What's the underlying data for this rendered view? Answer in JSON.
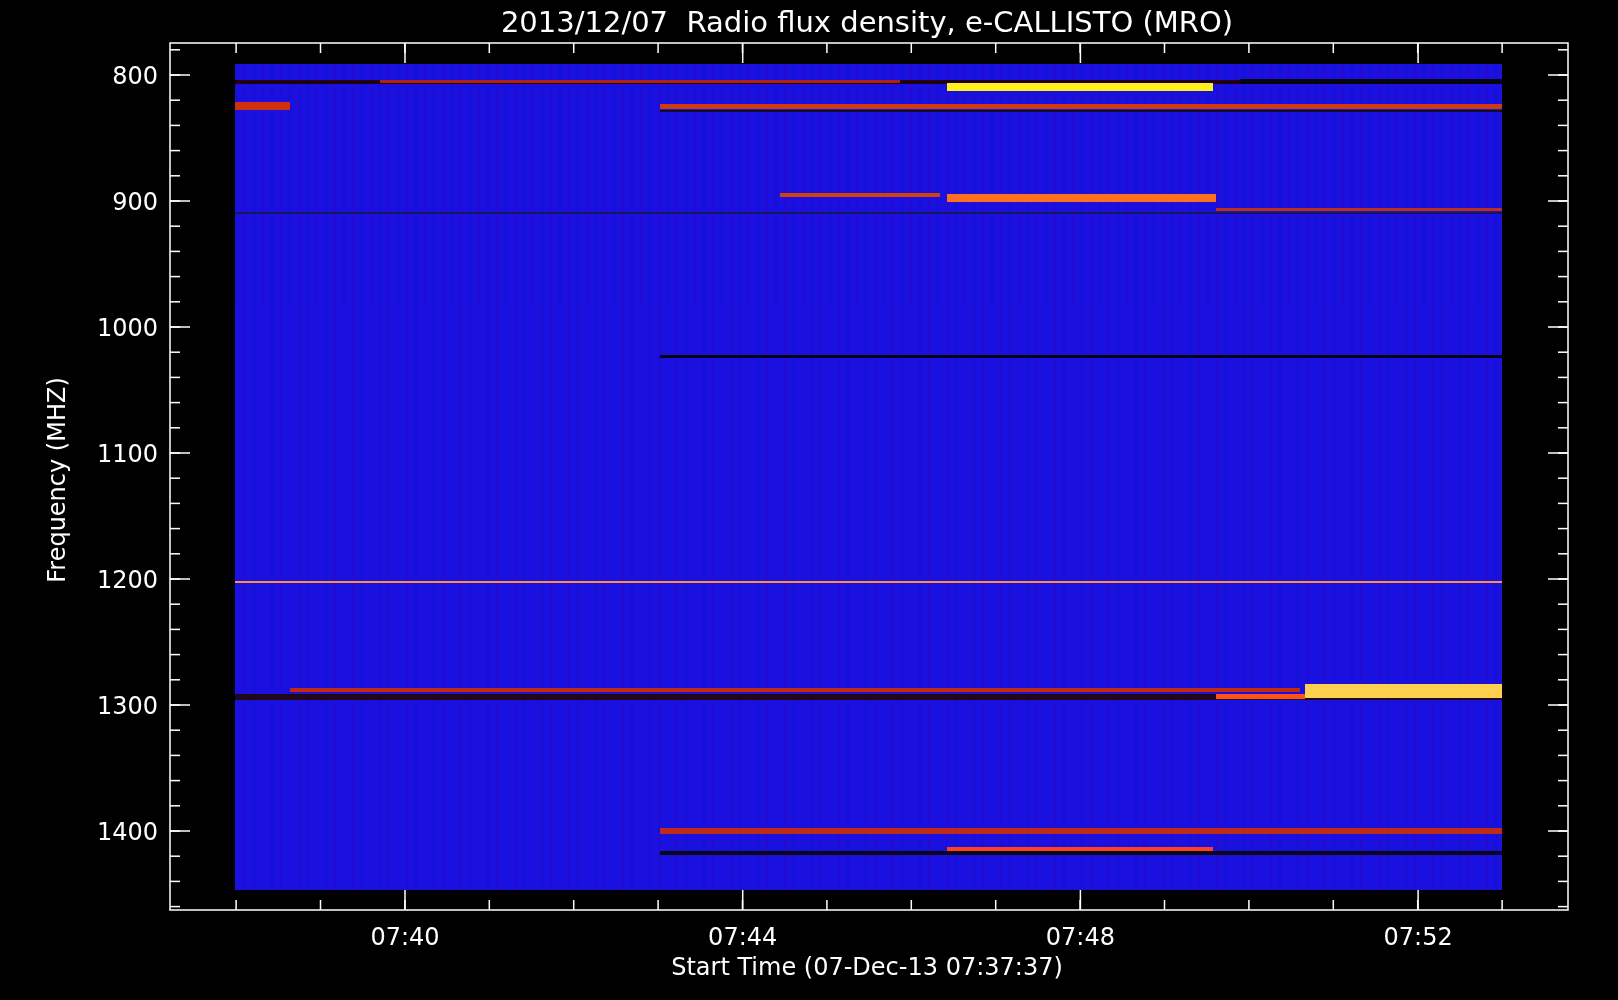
{
  "title": "2013/12/07  Radio flux density, e-CALLISTO (MRO)",
  "y_axis": {
    "label": "Frequency (MHZ)",
    "ticks": [
      "800",
      "900",
      "1000",
      "1100",
      "1200",
      "1300",
      "1400"
    ]
  },
  "x_axis": {
    "label": "Start Time (07-Dec-13 07:37:37)",
    "ticks": [
      "07:40",
      "07:44",
      "07:48",
      "07:52"
    ]
  }
}
